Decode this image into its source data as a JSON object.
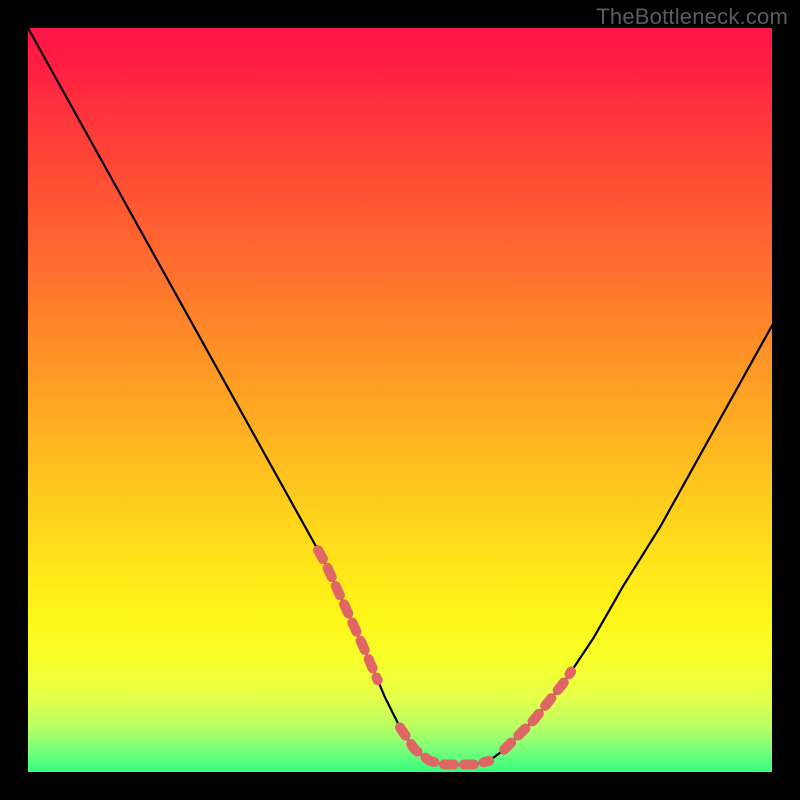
{
  "watermark": "TheBottleneck.com",
  "chart_data": {
    "type": "line",
    "title": "",
    "xlabel": "",
    "ylabel": "",
    "xlim": [
      0,
      100
    ],
    "ylim": [
      0,
      100
    ],
    "series": [
      {
        "name": "bottleneck-curve",
        "x": [
          0,
          5,
          10,
          15,
          20,
          25,
          30,
          35,
          40,
          45,
          48,
          50,
          52,
          54,
          56,
          58,
          60,
          62,
          64,
          68,
          72,
          76,
          80,
          85,
          90,
          95,
          100
        ],
        "values": [
          100,
          91,
          82,
          73,
          64,
          55,
          46,
          37,
          28,
          17,
          10,
          6,
          3,
          1.5,
          1,
          1,
          1,
          1.5,
          3,
          7,
          12,
          18,
          25,
          33,
          42,
          51,
          60
        ]
      }
    ],
    "highlight_segments": [
      {
        "name": "left-highlight",
        "x_range": [
          39,
          47
        ]
      },
      {
        "name": "bottom-highlight",
        "x_range": [
          50,
          62
        ]
      },
      {
        "name": "right-highlight",
        "x_range": [
          64,
          73
        ]
      }
    ],
    "gradient_stops": [
      {
        "pos": 0,
        "color": "#ff1448"
      },
      {
        "pos": 50,
        "color": "#ffaa22"
      },
      {
        "pos": 80,
        "color": "#fdf818"
      },
      {
        "pos": 100,
        "color": "#35ff7d"
      }
    ]
  }
}
